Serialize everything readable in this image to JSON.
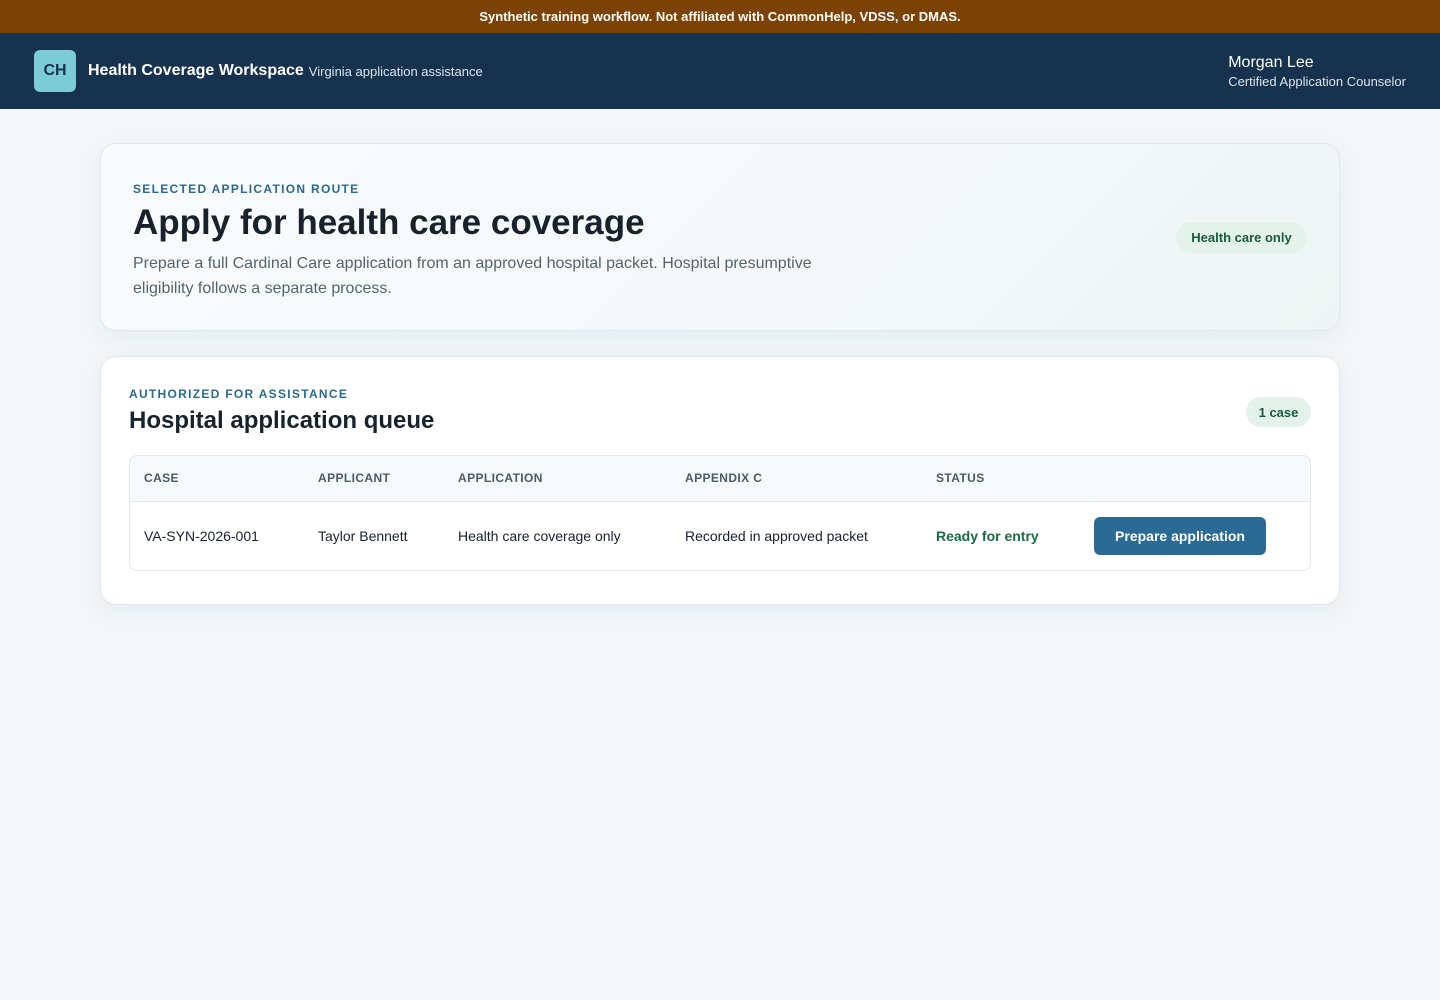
{
  "banner": {
    "text": "Synthetic training workflow. Not affiliated with CommonHelp, VDSS, or DMAS."
  },
  "header": {
    "logo_initials": "CH",
    "app_name": "Health Coverage Workspace",
    "app_subtitle": "Virginia application assistance",
    "user_name": "Morgan Lee",
    "user_role": "Certified Application Counselor"
  },
  "route": {
    "eyebrow": "SELECTED APPLICATION ROUTE",
    "title": "Apply for health care coverage",
    "description": "Prepare a full Cardinal Care application from an approved hospital packet. Hospital presumptive eligibility follows a separate process.",
    "badge": "Health care only"
  },
  "queue": {
    "eyebrow": "AUTHORIZED FOR ASSISTANCE",
    "title": "Hospital application queue",
    "count_badge": "1 case",
    "columns": [
      "CASE",
      "APPLICANT",
      "APPLICATION",
      "APPENDIX C",
      "STATUS",
      ""
    ],
    "rows": [
      {
        "case": "VA-SYN-2026-001",
        "applicant": "Taylor Bennett",
        "application": "Health care coverage only",
        "appendix_c": "Recorded in approved packet",
        "status": "Ready for entry",
        "action_label": "Prepare application"
      }
    ]
  },
  "colors": {
    "banner_bg": "#7b4203",
    "header_bg": "#16324f",
    "logo_bg": "#7bcdd5",
    "accent": "#2a6a95",
    "eyebrow": "#2a6a8f",
    "status_ready": "#1a6b43",
    "badge_bg": "#e3f3ec",
    "page_bg": "#f3f7fa"
  }
}
